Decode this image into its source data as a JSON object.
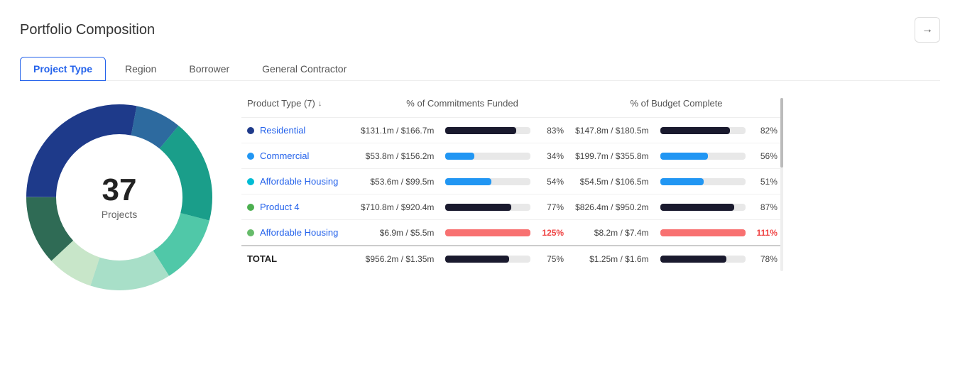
{
  "title": "Portfolio Composition",
  "arrow_button": "→",
  "tabs": [
    {
      "id": "project-type",
      "label": "Project Type",
      "active": true
    },
    {
      "id": "region",
      "label": "Region",
      "active": false
    },
    {
      "id": "borrower",
      "label": "Borrower",
      "active": false
    },
    {
      "id": "general-contractor",
      "label": "General Contractor",
      "active": false
    }
  ],
  "donut": {
    "count": "37",
    "label": "Projects",
    "segments": [
      {
        "color": "#1e3a8a",
        "pct": 28,
        "offset": 0
      },
      {
        "color": "#2d6a9f",
        "pct": 8,
        "offset": 28
      },
      {
        "color": "#1a9e8a",
        "pct": 18,
        "offset": 36
      },
      {
        "color": "#50c8a8",
        "pct": 12,
        "offset": 54
      },
      {
        "color": "#a8e6d0",
        "pct": 14,
        "offset": 66
      },
      {
        "color": "#c8e6c9",
        "pct": 8,
        "offset": 80
      },
      {
        "color": "#2f6b55",
        "pct": 12,
        "offset": 88
      }
    ]
  },
  "table": {
    "col1": "Product Type (7)",
    "col2": "% of Commitments Funded",
    "col3": "% of Budget Complete",
    "rows": [
      {
        "dot_color": "#1e3a8a",
        "name": "Residential",
        "cf_amount": "$131.1m / $166.7m",
        "cf_pct": 83,
        "cf_pct_label": "83%",
        "cf_over": false,
        "cf_bar_color": "#1a1a2e",
        "bc_amount": "$147.8m / $180.5m",
        "bc_pct": 82,
        "bc_pct_label": "82%",
        "bc_over": false,
        "bc_bar_color": "#1a1a2e"
      },
      {
        "dot_color": "#2196f3",
        "name": "Commercial",
        "cf_amount": "$53.8m / $156.2m",
        "cf_pct": 34,
        "cf_pct_label": "34%",
        "cf_over": false,
        "cf_bar_color": "#2196f3",
        "bc_amount": "$199.7m / $355.8m",
        "bc_pct": 56,
        "bc_pct_label": "56%",
        "bc_over": false,
        "bc_bar_color": "#2196f3"
      },
      {
        "dot_color": "#00bcd4",
        "name": "Affordable Housing",
        "cf_amount": "$53.6m / $99.5m",
        "cf_pct": 54,
        "cf_pct_label": "54%",
        "cf_over": false,
        "cf_bar_color": "#2196f3",
        "bc_amount": "$54.5m / $106.5m",
        "bc_pct": 51,
        "bc_pct_label": "51%",
        "bc_over": false,
        "bc_bar_color": "#2196f3"
      },
      {
        "dot_color": "#4caf50",
        "name": "Product 4",
        "cf_amount": "$710.8m / $920.4m",
        "cf_pct": 77,
        "cf_pct_label": "77%",
        "cf_over": false,
        "cf_bar_color": "#1a1a2e",
        "bc_amount": "$826.4m / $950.2m",
        "bc_pct": 87,
        "bc_pct_label": "87%",
        "bc_over": false,
        "bc_bar_color": "#1a1a2e"
      },
      {
        "dot_color": "#66bb6a",
        "name": "Affordable Housing",
        "cf_amount": "$6.9m / $5.5m",
        "cf_pct": 100,
        "cf_pct_label": "125%",
        "cf_over": true,
        "cf_bar_color": "#f87171",
        "bc_amount": "$8.2m / $7.4m",
        "bc_pct": 100,
        "bc_pct_label": "111%",
        "bc_over": true,
        "bc_bar_color": "#f87171"
      }
    ],
    "total": {
      "label": "TOTAL",
      "cf_amount": "$956.2m / $1.35m",
      "cf_pct": 75,
      "cf_pct_label": "75%",
      "cf_over": false,
      "cf_bar_color": "#1a1a2e",
      "bc_amount": "$1.25m / $1.6m",
      "bc_pct": 78,
      "bc_pct_label": "78%",
      "bc_over": false,
      "bc_bar_color": "#1a1a2e"
    }
  }
}
